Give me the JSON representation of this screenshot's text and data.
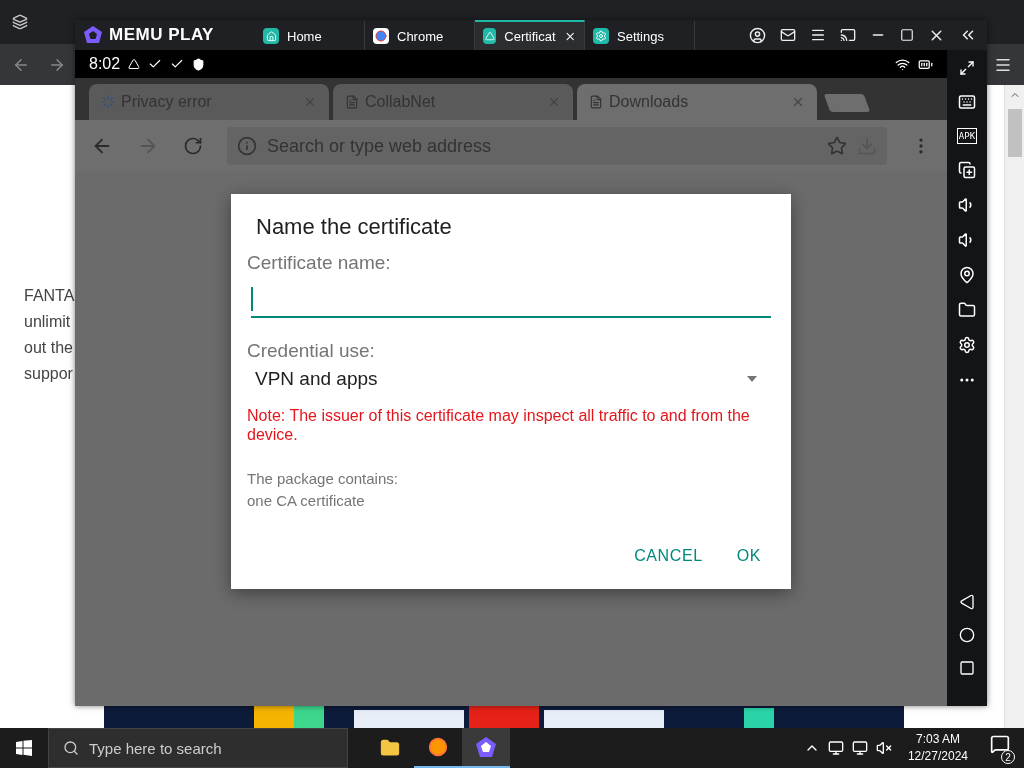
{
  "desktop_browser": {
    "page_text": [
      "FANTA",
      "unlimit",
      "out the",
      "suppor"
    ]
  },
  "emulator": {
    "brand": "MEMU PLAY",
    "tabs": [
      {
        "label": "Home",
        "selected": false,
        "closable": false
      },
      {
        "label": "Chrome",
        "selected": false,
        "closable": false
      },
      {
        "label": "Certificat",
        "selected": true,
        "closable": true
      },
      {
        "label": "Settings",
        "selected": false,
        "closable": false
      }
    ],
    "status_bar": {
      "time": "8:02"
    },
    "side_panel": {
      "apk_label": "APK"
    }
  },
  "chrome": {
    "tabs": [
      {
        "title": "Privacy error",
        "loading": true,
        "selected": false
      },
      {
        "title": "CollabNet",
        "loading": false,
        "selected": false
      },
      {
        "title": "Downloads",
        "loading": false,
        "selected": true
      }
    ],
    "address_placeholder": "Search or type web address"
  },
  "dialog": {
    "title": "Name the certificate",
    "name_label": "Certificate name:",
    "credential_label": "Credential use:",
    "credential_value": "VPN and apps",
    "warning": "Note: The issuer of this certificate may inspect all traffic to and from the device.",
    "package_label": "The package contains:",
    "package_content": "one CA certificate",
    "buttons": [
      "CANCEL",
      "OK"
    ]
  },
  "taskbar": {
    "search_placeholder": "Type here to search",
    "time": "7:03 AM",
    "date": "12/27/2024",
    "notification_count": "2"
  }
}
